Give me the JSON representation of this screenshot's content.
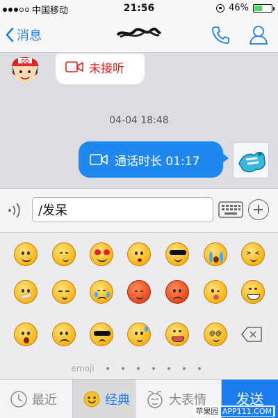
{
  "status_bar": {
    "carrier": "中国移动",
    "time": "21:56",
    "battery": "46%",
    "battery_level": 0.46
  },
  "nav": {
    "back_label": "消息",
    "title": ""
  },
  "chat": {
    "missed_call": "未接听",
    "timestamp": "04-04 18:48",
    "call_duration": "通话时长 01:17"
  },
  "input": {
    "value": "/发呆"
  },
  "emoji_panel": {
    "page_label": "emoji",
    "page_count": 7
  },
  "toolbar": {
    "recent": "最近",
    "classic": "经典",
    "big": "大表情",
    "send": "发送"
  },
  "watermark": {
    "brand": "苹果园",
    "site": "APP111.COM"
  },
  "colors": {
    "accent": "#1a7cf0",
    "missed": "#e02020",
    "bubble": "#1e88ee"
  }
}
